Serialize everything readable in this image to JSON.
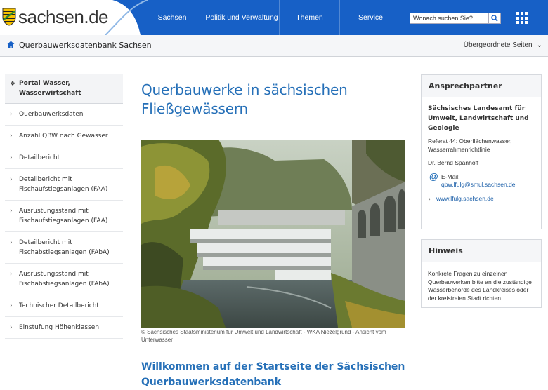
{
  "header": {
    "logo_text": "sachsen.de",
    "nav": [
      {
        "label": "Sachsen"
      },
      {
        "label": "Politik und Verwaltung"
      },
      {
        "label": "Themen"
      },
      {
        "label": "Service"
      }
    ],
    "search_placeholder": "Wonach suchen Sie?",
    "colors": {
      "nav_blue": "#1760c6",
      "accent_blue": "#2670b8",
      "link_blue": "#1a5ea8"
    }
  },
  "breadcrumb": {
    "title": "Querbauwerksdatenbank Sachsen",
    "parent_pages": "Übergeordnete Seiten"
  },
  "sidebar": {
    "items": [
      {
        "label": "Portal Wasser, Wasserwirtschaft",
        "active": true
      },
      {
        "label": "Querbauwerksdaten"
      },
      {
        "label": "Anzahl QBW nach Gewässer"
      },
      {
        "label": "Detailbericht"
      },
      {
        "label": "Detailbericht mit Fischaufstiegsanlagen (FAA)"
      },
      {
        "label": "Ausrüstungsstand mit Fischaufstiegsanlagen (FAA)"
      },
      {
        "label": "Detailbericht mit Fischabstiegsanlagen (FAbA)"
      },
      {
        "label": "Ausrüstungsstand mit Fischabstiegsanlagen (FAbA)"
      },
      {
        "label": "Technischer Detailbericht"
      },
      {
        "label": "Einstufung Höhenklassen"
      }
    ]
  },
  "main": {
    "title": "Querbauwerke in sächsischen Fließgewässern",
    "image_caption": "© Sächsisches Staatsministerium für Umwelt und Landwirtschaft - WKA Niezelgrund - Ansicht vom Unterwasser",
    "welcome_heading": "Willkommen auf der Startseite der Sächsischen Querbauwerksdatenbank"
  },
  "contact": {
    "heading": "Ansprechpartner",
    "organisation": "Sächsisches Landesamt für Umwelt, Landwirtschaft und Geologie",
    "department": "Referat 44: Oberflächenwasser, Wasserrahmenrichtlinie",
    "person": "Dr. Bernd Spänhoff",
    "email_label": "E-Mail:",
    "email": "qbw.lfulg@smul.sachsen.de",
    "website": "www.lfulg.sachsen.de"
  },
  "hint": {
    "heading": "Hinweis",
    "text": "Konkrete Fragen zu einzelnen Querbauwerken bitte an die zuständige Wasserbehörde des Landkreises oder der kreisfreien Stadt richten."
  }
}
